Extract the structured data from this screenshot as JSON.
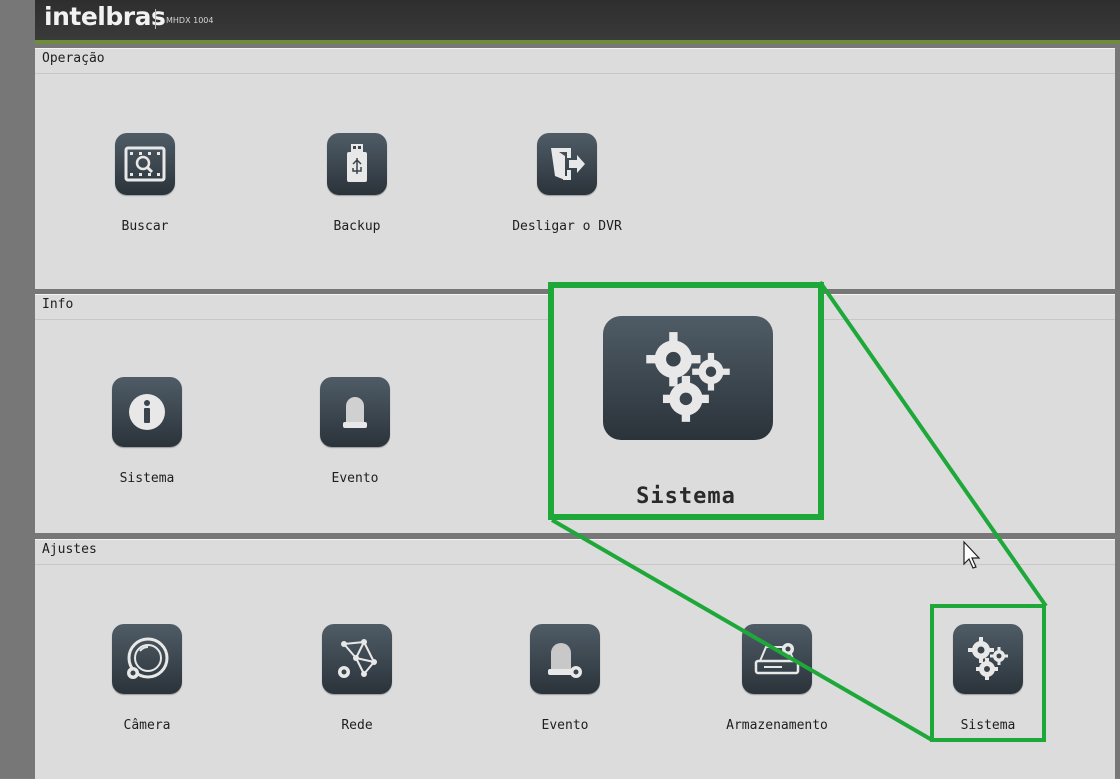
{
  "header": {
    "brand": "intelbras",
    "model": "MHDX 1004"
  },
  "sections": [
    {
      "title": "Operação",
      "items": [
        {
          "label": "Buscar",
          "icon": "search-film-icon"
        },
        {
          "label": "Backup",
          "icon": "usb-drive-icon"
        },
        {
          "label": "Desligar o DVR",
          "icon": "logout-door-icon"
        }
      ]
    },
    {
      "title": "Info",
      "items": [
        {
          "label": "Sistema",
          "icon": "info-icon"
        },
        {
          "label": "Evento",
          "icon": "alarm-light-icon"
        }
      ]
    },
    {
      "title": "Ajustes",
      "items": [
        {
          "label": "Câmera",
          "icon": "camera-gear-icon"
        },
        {
          "label": "Rede",
          "icon": "network-gear-icon"
        },
        {
          "label": "Evento",
          "icon": "alarm-gear-icon"
        },
        {
          "label": "Armazenamento",
          "icon": "hdd-gear-icon"
        },
        {
          "label": "Sistema",
          "icon": "gears-icon"
        }
      ]
    }
  ],
  "callout": {
    "label": "Sistema",
    "icon": "gears-icon",
    "highlight_color": "#1ea83a"
  },
  "colors": {
    "panel": "#dcdcdc",
    "tile": "#3a444c",
    "accent": "#6f8c3a"
  }
}
